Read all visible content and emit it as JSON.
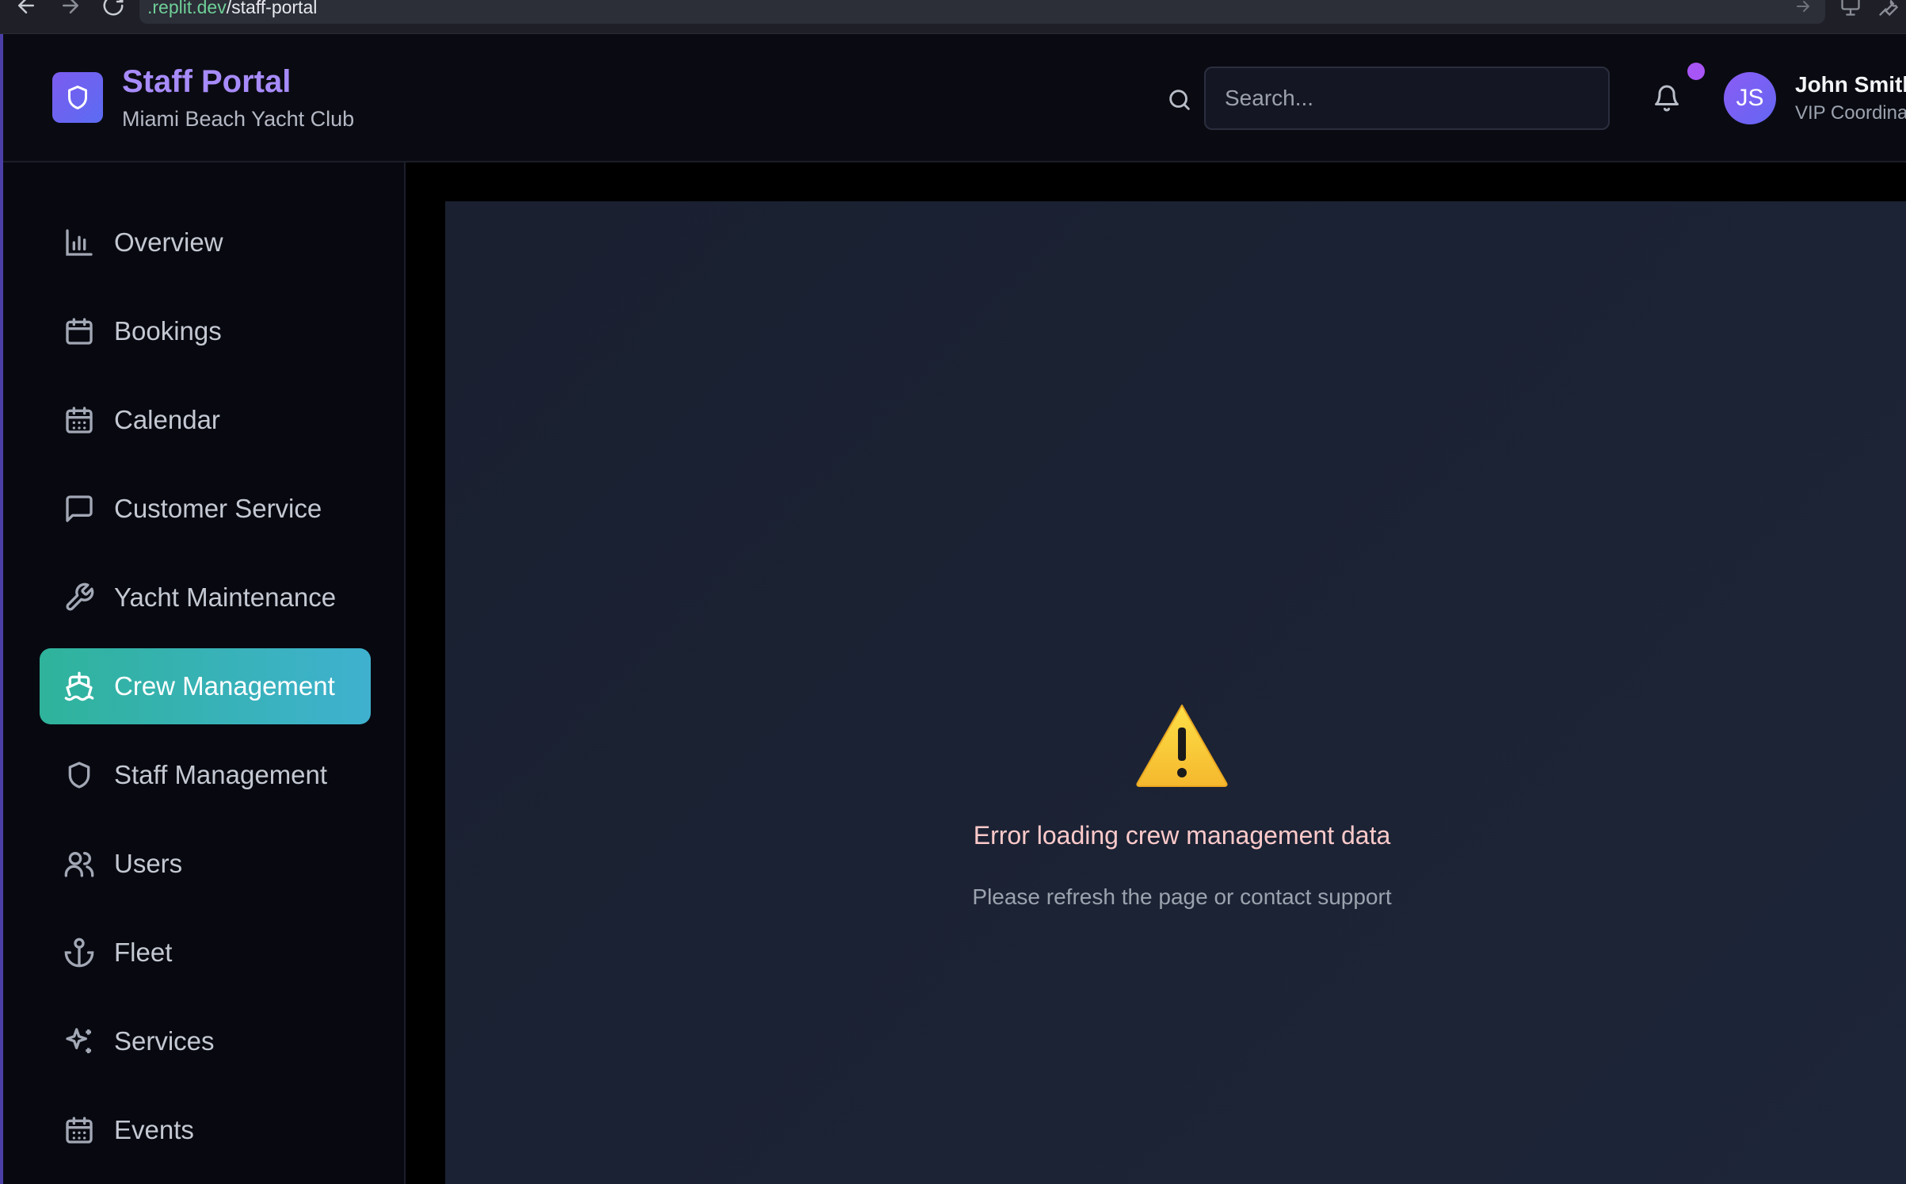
{
  "browser": {
    "url_host": ".replit.dev",
    "url_path": "/staff-portal"
  },
  "header": {
    "title": "Staff Portal",
    "subtitle": "Miami Beach Yacht Club",
    "search_placeholder": "Search...",
    "notification_dot_color": "#a855f7",
    "user": {
      "initials": "JS",
      "name": "John Smith",
      "role": "VIP Coordina"
    }
  },
  "sidebar": {
    "items": [
      {
        "label": "Overview",
        "icon": "bar-chart-icon",
        "active": false
      },
      {
        "label": "Bookings",
        "icon": "calendar-icon",
        "active": false
      },
      {
        "label": "Calendar",
        "icon": "calendar-grid-icon",
        "active": false
      },
      {
        "label": "Customer Service",
        "icon": "message-square-icon",
        "active": false
      },
      {
        "label": "Yacht Maintenance",
        "icon": "wrench-icon",
        "active": false
      },
      {
        "label": "Crew Management",
        "icon": "ship-icon",
        "active": true
      },
      {
        "label": "Staff Management",
        "icon": "shield-icon",
        "active": false
      },
      {
        "label": "Users",
        "icon": "users-icon",
        "active": false
      },
      {
        "label": "Fleet",
        "icon": "anchor-icon",
        "active": false
      },
      {
        "label": "Services",
        "icon": "sparkles-icon",
        "active": false
      },
      {
        "label": "Events",
        "icon": "calendar-days-icon",
        "active": false
      }
    ]
  },
  "main": {
    "error_icon": "warning-icon",
    "error_title": "Error loading crew management data",
    "error_message": "Please refresh the page or contact support"
  },
  "colors": {
    "accent": "#a78bfa",
    "active_nav_start": "#2fb39b",
    "active_nav_end": "#3fb1cf"
  }
}
